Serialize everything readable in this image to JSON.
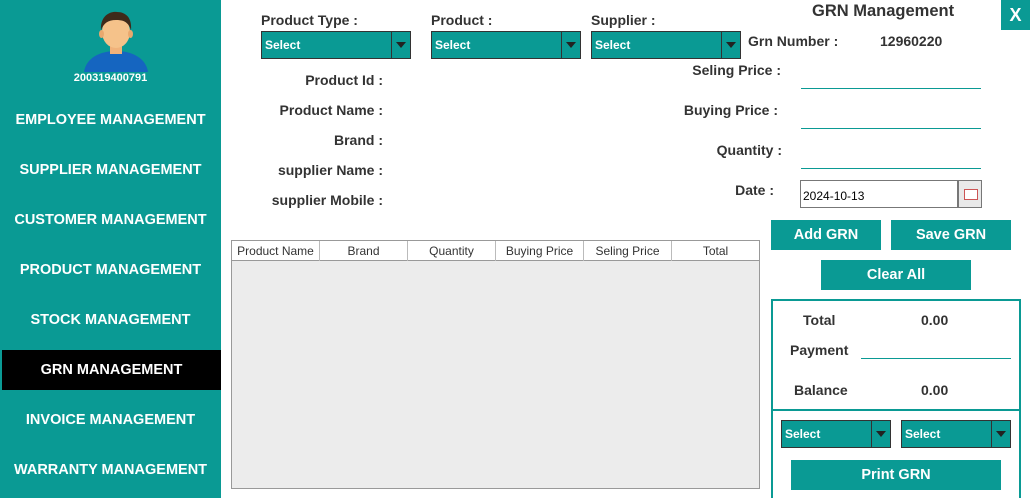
{
  "sidebar": {
    "user_id": "200319400791",
    "items": [
      {
        "label": "EMPLOYEE MANAGEMENT"
      },
      {
        "label": "SUPPLIER MANAGEMENT"
      },
      {
        "label": "CUSTOMER MANAGEMENT"
      },
      {
        "label": "PRODUCT MANAGEMENT"
      },
      {
        "label": "STOCK MANAGEMENT"
      },
      {
        "label": "GRN MANAGEMENT"
      },
      {
        "label": "INVOICE MANAGEMENT"
      },
      {
        "label": "WARRANTY MANAGEMENT"
      }
    ],
    "active_index": 5
  },
  "header": {
    "title": "GRN Management",
    "close_label": "X"
  },
  "filters": {
    "product_type_label": "Product  Type :",
    "product_type_value": "Select",
    "product_label": "Product :",
    "product_value": "Select",
    "supplier_label": "Supplier :",
    "supplier_value": "Select"
  },
  "grn": {
    "number_label": "Grn Number :",
    "number_value": "12960220"
  },
  "details": {
    "product_id_label": "Product Id :",
    "product_name_label": "Product Name :",
    "brand_label": "Brand :",
    "supplier_name_label": "supplier Name :",
    "supplier_mobile_label": "supplier Mobile :"
  },
  "pricing": {
    "selling_price_label": "Seling Price :",
    "buying_price_label": "Buying Price :",
    "quantity_label": "Quantity :",
    "date_label": "Date :",
    "date_value": "2024-10-13"
  },
  "actions": {
    "add_grn": "Add GRN",
    "save_grn": "Save GRN",
    "clear_all": "Clear All",
    "print_grn": "Print GRN"
  },
  "table": {
    "columns": [
      "Product Name",
      "Brand",
      "Quantity",
      "Buying Price",
      "Seling Price",
      "Total"
    ],
    "rows": []
  },
  "summary": {
    "total_label": "Total",
    "total_value": "0.00",
    "payment_label": "Payment",
    "balance_label": "Balance",
    "balance_value": "0.00",
    "select_1": "Select",
    "select_2": "Select"
  },
  "colors": {
    "accent": "#0a9a94",
    "active_nav": "#000000"
  }
}
